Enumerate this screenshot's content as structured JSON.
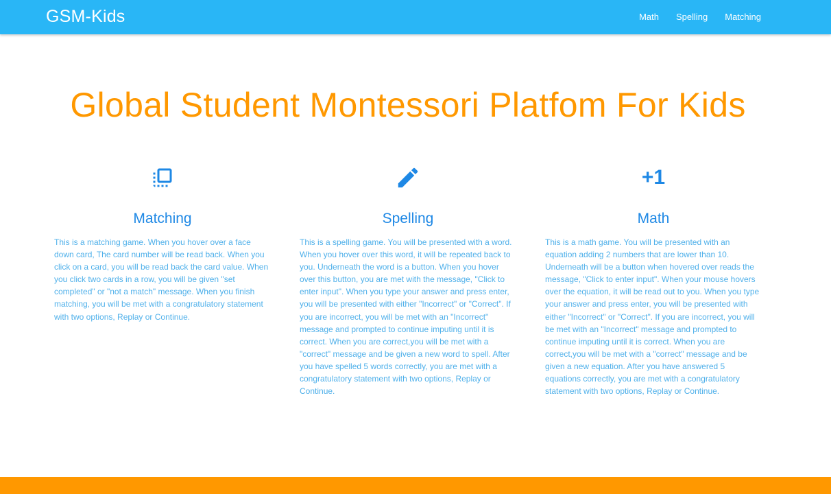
{
  "navbar": {
    "brand": "GSM-Kids",
    "links": [
      "Math",
      "Spelling",
      "Matching"
    ]
  },
  "hero": {
    "title": "Global Student Montessori Platfom For Kids"
  },
  "cards": [
    {
      "icon": "flip-to-front-icon",
      "title": "Matching",
      "text": "This is a matching game. When you hover over a face down card, The card number will be read back. When you click on a card, you will be read back the card value. When you click two cards in a row, you will be given \"set completed\" or \"not a match\" message. When you finish matching, you will be met with a congratulatory statement with two options, Replay or Continue."
    },
    {
      "icon": "pencil-icon",
      "title": "Spelling",
      "text": "This is a spelling game. You will be presented with a word. When you hover over this word, it will be repeated back to you. Underneath the word is a button. When you hover over this button, you are met with the message, \"Click to enter input\". When you type your answer and press enter, you will be presented with either \"Incorrect\" or \"Correct\". If you are incorrect, you will be met with an \"Incorrect\" message and prompted to continue imputing until it is correct. When you are correct,you will be met with a \"correct\" message and be given a new word to spell. After you have spelled 5 words correctly, you are met with a congratulatory statement with two options, Replay or Continue."
    },
    {
      "icon": "plus-one-icon",
      "icon_text": "+1",
      "title": "Math",
      "text": "This is a math game. You will be presented with an equation adding 2 numbers that are lower than 10. Underneath will be a button when hovered over reads the message, \"Click to enter input\". When your mouse hovers over the equation, it will be read out to you. When you type your answer and press enter, you will be presented with either \"Incorrect\" or \"Correct\". If you are incorrect, you will be met with an \"Incorrect\" message and prompted to continue imputing until it is correct. When you are correct,you will be met with a \"correct\" message and be given a new equation. After you have answered 5 equations correctly, you are met with a congratulatory statement with two options, Replay or Continue."
    }
  ],
  "colors": {
    "navbar": "#29b6f6",
    "accent_orange": "#ff9800",
    "title_blue": "#1e88e5",
    "text_blue": "#4fb0ea"
  }
}
